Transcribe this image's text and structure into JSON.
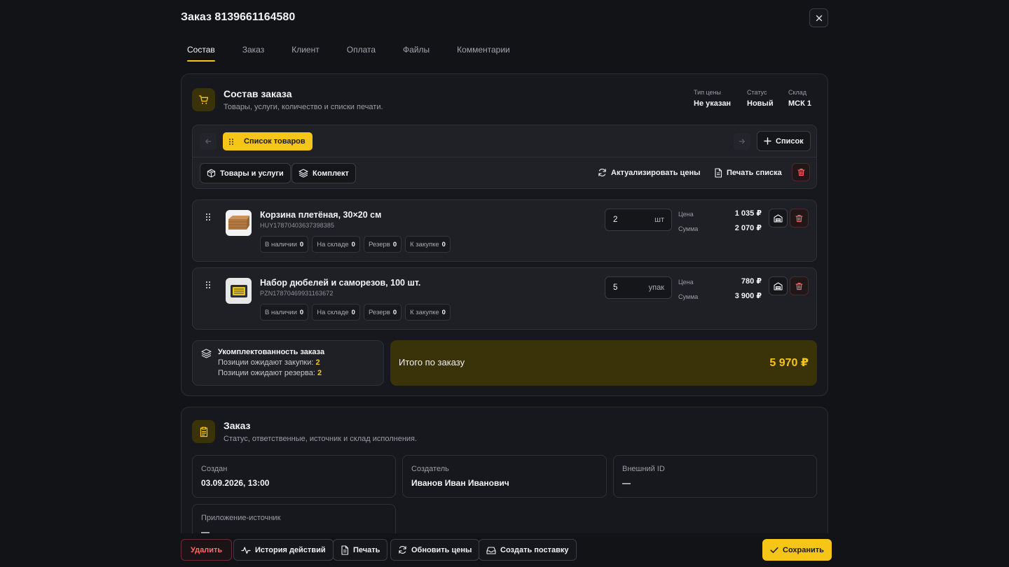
{
  "header": {
    "title": "Заказ 8139661164580"
  },
  "tabs": [
    {
      "label": "Состав",
      "active": true
    },
    {
      "label": "Заказ"
    },
    {
      "label": "Клиент"
    },
    {
      "label": "Оплата"
    },
    {
      "label": "Файлы"
    },
    {
      "label": "Комментарии"
    }
  ],
  "composition": {
    "title": "Состав заказа",
    "subtitle": "Товары, услуги, количество и списки печати.",
    "meta": [
      {
        "label": "Тип цены",
        "value": "Не указан"
      },
      {
        "label": "Статус",
        "value": "Новый"
      },
      {
        "label": "Склад",
        "value": "МСК 1"
      }
    ],
    "toolbar": {
      "list_chip": "Список товаров",
      "add_list": "Список",
      "goods_services": "Товары и услуги",
      "bundle": "Комплект",
      "update_prices": "Актуализировать цены",
      "print_list": "Печать списка"
    },
    "items": [
      {
        "name": "Корзина плетёная, 30×20 см",
        "sku": "HUY17870403637398385",
        "stock": [
          {
            "label": "В наличии",
            "value": "0"
          },
          {
            "label": "На складе",
            "value": "0"
          },
          {
            "label": "Резерв",
            "value": "0"
          },
          {
            "label": "К закупке",
            "value": "0"
          }
        ],
        "qty": "2",
        "unit": "шт",
        "price_label": "Цена",
        "price": "1 035 ₽",
        "sum_label": "Сумма",
        "sum": "2 070 ₽"
      },
      {
        "name": "Набор дюбелей и саморезов, 100 шт.",
        "sku": "PZN17870469931163672",
        "stock": [
          {
            "label": "В наличии",
            "value": "0"
          },
          {
            "label": "На складе",
            "value": "0"
          },
          {
            "label": "Резерв",
            "value": "0"
          },
          {
            "label": "К закупке",
            "value": "0"
          }
        ],
        "qty": "5",
        "unit": "упак",
        "price_label": "Цена",
        "price": "780 ₽",
        "sum_label": "Сумма",
        "sum": "3 900 ₽"
      }
    ],
    "completeness": {
      "title": "Укомплектованность заказа",
      "awaiting_purchase_label": "Позиции ожидают закупки:",
      "awaiting_purchase": "2",
      "awaiting_reserve_label": "Позиции ожидают резерва:",
      "awaiting_reserve": "2"
    },
    "total": {
      "label": "Итого по заказу",
      "value": "5 970 ₽"
    }
  },
  "order": {
    "title": "Заказ",
    "subtitle": "Статус, ответственные, источник и склад исполнения.",
    "fields": [
      {
        "label": "Создан",
        "value": "03.09.2026, 13:00"
      },
      {
        "label": "Создатель",
        "value": "Иванов Иван Иванович"
      },
      {
        "label": "Внешний ID",
        "value": "—"
      },
      {
        "label": "Приложение-источник",
        "value": "—"
      }
    ]
  },
  "footer": {
    "delete": "Удалить",
    "history": "История действий",
    "print": "Печать",
    "update_prices": "Обновить цены",
    "create_supply": "Создать поставку",
    "save": "Сохранить"
  },
  "colors": {
    "accent": "#f5c518",
    "background": "#121317",
    "card": "#17181d",
    "danger": "#ff6b6b"
  }
}
